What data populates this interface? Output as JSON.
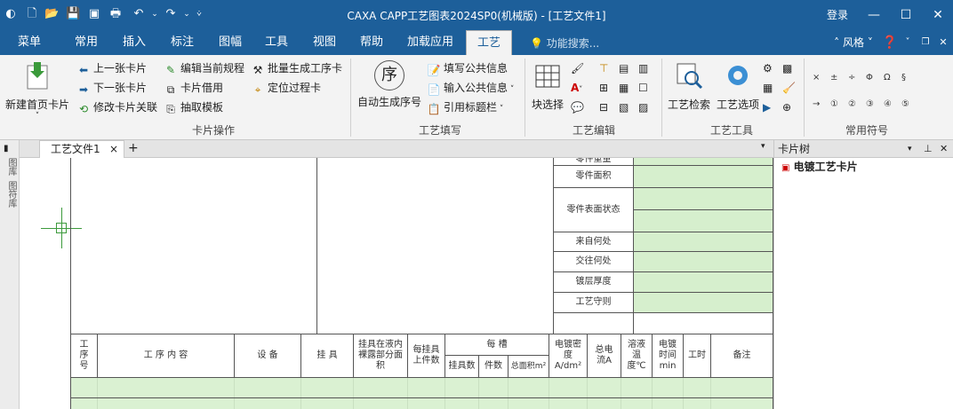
{
  "titlebar": {
    "title": "CAXA CAPP工艺图表2024SP0(机械版) - [工艺文件1]",
    "login": "登录",
    "minimize": "—",
    "maximize": "☐",
    "close": "✕"
  },
  "menubar": {
    "items": [
      "菜单",
      "常用",
      "插入",
      "标注",
      "图幅",
      "工具",
      "视图",
      "帮助",
      "加载应用",
      "工艺"
    ],
    "active": "工艺",
    "search_placeholder": "功能搜索...",
    "style_label": "风格"
  },
  "ribbon": {
    "card_ops": {
      "label": "卡片操作",
      "new_first_page": "新建首页卡片",
      "prev_card": "上一张卡片",
      "next_card": "下一张卡片",
      "modify_card_link": "修改卡片关联",
      "edit_current_spec": "编辑当前规程",
      "card_borrow": "卡片借用",
      "extract_template": "抽取模板",
      "batch_generate": "批量生成工序卡",
      "locate_process_card": "定位过程卡"
    },
    "fill": {
      "label": "工艺填写",
      "auto_seq": "自动生成序号",
      "auto_seq_glyph": "序",
      "fill_public_info": "填写公共信息",
      "input_public_info": "输入公共信息",
      "ref_title_bar": "引用标题栏"
    },
    "edit": {
      "label": "工艺编辑",
      "block_select": "块选择"
    },
    "tools": {
      "label": "工艺工具",
      "search": "工艺检索",
      "options": "工艺选项"
    },
    "symbols": {
      "label": "常用符号",
      "row1": [
        "×",
        "±",
        "÷",
        "Φ",
        "Ω",
        "§"
      ],
      "row2": [
        "→",
        "①",
        "②",
        "③",
        "④",
        "⑤"
      ]
    }
  },
  "document": {
    "tab_label": "工艺文件1",
    "tab_close": "×",
    "tab_add": "+",
    "left_tool_labels": [
      "图库",
      "图符库"
    ]
  },
  "form": {
    "info_rows": [
      "零件重量",
      "零件面积",
      "零件表面状态",
      "来自何处",
      "交往何处",
      "镀层厚度",
      "工艺守则"
    ],
    "headers": {
      "seq": "工序号",
      "content": "工 序 内 容",
      "equipment": "设 备",
      "fixture": "挂 具",
      "immersed_area": "挂具在液内裸露部分面积",
      "pieces_per_fixture": "每挂具上件数",
      "per_tank": "每 槽",
      "fixture_count": "挂具数",
      "piece_count": "件数",
      "total_area": "总面积m²",
      "current_density": "电镀密度A/dm²",
      "total_current": "总电流A",
      "solution_temp": "溶液温度℃",
      "plating_time": "电镀时间min",
      "work_hours": "工时",
      "remarks": "备注"
    }
  },
  "card_tree": {
    "title": "卡片树",
    "root": "电镀工艺卡片"
  },
  "colors": {
    "titlebar": "#1d5f9a",
    "cell_fill": "#d6efcd"
  }
}
